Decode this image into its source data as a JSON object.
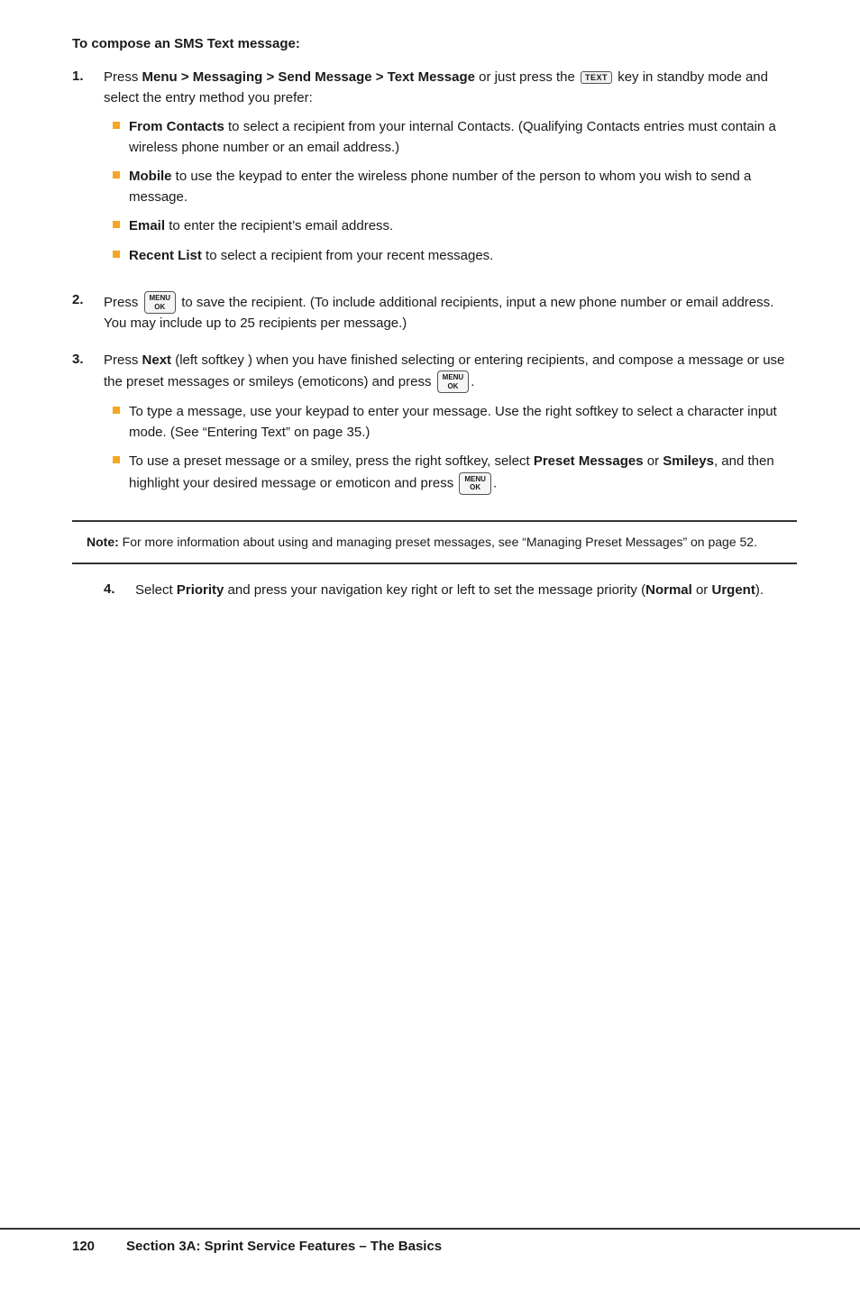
{
  "page": {
    "intro_heading": "To compose an SMS Text message:",
    "steps": [
      {
        "number": "1.",
        "text_parts": [
          {
            "type": "text",
            "content": "Press "
          },
          {
            "type": "bold",
            "content": "Menu > Messaging > Send Message > Text Message"
          },
          {
            "type": "text",
            "content": " or just press the "
          },
          {
            "type": "key_text",
            "content": "TEXT"
          },
          {
            "type": "text",
            "content": " key in standby mode and select the entry method you prefer:"
          }
        ],
        "bullets": [
          {
            "text_parts": [
              {
                "type": "bold",
                "content": "From Contacts"
              },
              {
                "type": "text",
                "content": " to select a recipient from your internal Contacts. (Qualifying Contacts entries must contain a wireless phone number or an email address.)"
              }
            ]
          },
          {
            "text_parts": [
              {
                "type": "bold",
                "content": "Mobile"
              },
              {
                "type": "text",
                "content": " to use the keypad to enter the wireless phone number of the person to whom you wish to send a message."
              }
            ]
          },
          {
            "text_parts": [
              {
                "type": "bold",
                "content": "Email"
              },
              {
                "type": "text",
                "content": " to enter the recipient’s email address."
              }
            ]
          },
          {
            "text_parts": [
              {
                "type": "bold",
                "content": "Recent List"
              },
              {
                "type": "text",
                "content": " to select a recipient from your recent messages."
              }
            ]
          }
        ]
      },
      {
        "number": "2.",
        "text_parts": [
          {
            "type": "text",
            "content": "Press "
          },
          {
            "type": "key_menu_ok"
          },
          {
            "type": "text",
            "content": " to save the recipient. (To include additional recipients, input a new phone number or email address. You may include up to 25 recipients per message.)"
          }
        ],
        "bullets": []
      },
      {
        "number": "3.",
        "text_parts": [
          {
            "type": "text",
            "content": "Press "
          },
          {
            "type": "bold",
            "content": "Next"
          },
          {
            "type": "text",
            "content": " (left softkey ) when you have finished selecting or entering recipients, and compose a message or use the preset messages or smileys (emoticons) and press "
          },
          {
            "type": "key_menu_ok"
          },
          {
            "type": "text",
            "content": "."
          }
        ],
        "bullets": [
          {
            "text_parts": [
              {
                "type": "text",
                "content": "To type a message, use your keypad to enter your message. Use the right softkey to select a character input mode. (See “Entering Text” on page 35.)"
              }
            ]
          },
          {
            "text_parts": [
              {
                "type": "text",
                "content": "To use a preset  message or a smiley, press the right softkey, select "
              },
              {
                "type": "bold",
                "content": "Preset Messages"
              },
              {
                "type": "text",
                "content": " or "
              },
              {
                "type": "bold",
                "content": "Smileys"
              },
              {
                "type": "text",
                "content": ", and then highlight your desired message or emoticon and press "
              },
              {
                "type": "key_menu_ok"
              },
              {
                "type": "text",
                "content": "."
              }
            ]
          }
        ]
      }
    ],
    "note": {
      "label": "Note:",
      "text": " For more information about using and managing preset  messages, see “Managing Preset Messages” on page 52."
    },
    "step4": {
      "number": "4.",
      "text_parts": [
        {
          "type": "text",
          "content": "Select "
        },
        {
          "type": "bold",
          "content": "Priority"
        },
        {
          "type": "text",
          "content": " and press your navigation key right or left to set the message priority ("
        },
        {
          "type": "bold",
          "content": "Normal"
        },
        {
          "type": "text",
          "content": " or "
        },
        {
          "type": "bold",
          "content": "Urgent"
        },
        {
          "type": "text",
          "content": ")."
        }
      ]
    },
    "footer": {
      "page_number": "120",
      "section_text": "Section 3A: Sprint Service Features – The Basics"
    }
  }
}
